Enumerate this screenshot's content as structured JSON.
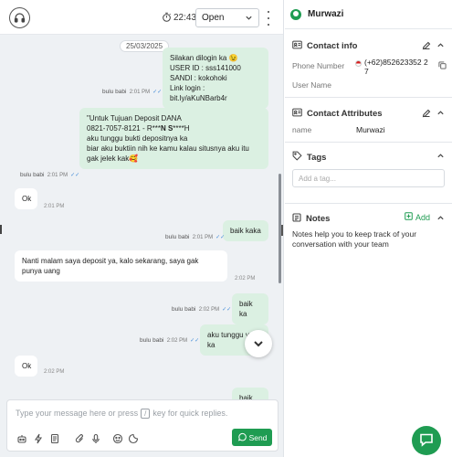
{
  "header": {
    "timer": "22:43",
    "status": "Open"
  },
  "messages": {
    "date": "25/03/2025",
    "m1": {
      "text": "Silakan dilogin ka 😉\nUSER ID : sss141000\nSANDI : kokohoki\nLink login : bit.ly/aKuNBarb4r",
      "sender": "bulu babi",
      "time": "2:01 PM"
    },
    "m2": {
      "line1": "\"Untuk Tujuan Deposit DANA",
      "line2": "0821-7057-8121 - R***",
      "line2b": "N S",
      "line2c": "****H",
      "rest": "\naku tunggu bukti depositnya ka\nbiar aku buktiin nih ke kamu kalau situsnya aku itu gak jelek kak🥰",
      "sender": "bulu babi",
      "time": "2:01 PM"
    },
    "m3": {
      "text": "Ok",
      "time": "2:01 PM"
    },
    "m4": {
      "text": "baik kaka",
      "sender": "bulu babi",
      "time": "2:01 PM"
    },
    "m5": {
      "text": "Nanti malam saya deposit ya, kalo sekarang, saya gak punya uang",
      "time": "2:02 PM"
    },
    "m6": {
      "text": "baik ka",
      "sender": "bulu babi",
      "time": "2:02 PM"
    },
    "m7": {
      "text": "aku tunggu ya ka",
      "sender": "bulu babi",
      "time": "2:02 PM"
    },
    "m8": {
      "text": "Ok",
      "time": "2:02 PM"
    },
    "m9": {
      "text": "baik ka"
    }
  },
  "composer": {
    "placeholder_a": "Type your message here or press",
    "slash": "/",
    "placeholder_b": "key for quick replies.",
    "send_label": "Send"
  },
  "contact": {
    "name": "Murwazi",
    "info_title": "Contact info",
    "phone_label": "Phone Number",
    "phone_value_1": "(+62)852623352 2",
    "phone_value_2": "7",
    "username_label": "User Name",
    "attributes_title": "Contact Attributes",
    "attr_name_label": "name",
    "attr_name_value": "Murwazi",
    "tags_title": "Tags",
    "tag_placeholder": "Add a tag...",
    "notes_title": "Notes",
    "add_label": "Add",
    "notes_text": "Notes help you to keep track of your conversation with your team"
  },
  "colors": {
    "accent": "#1f9c52",
    "outgoing_bubble": "#dbf0e2",
    "chat_background": "#eef1f4"
  }
}
